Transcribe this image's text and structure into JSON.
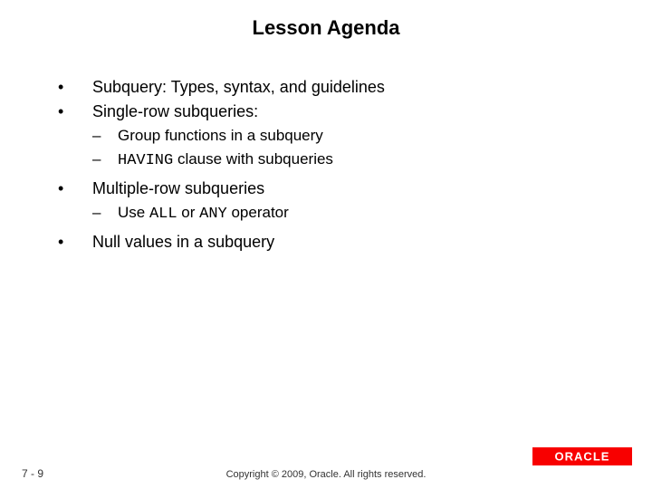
{
  "title": "Lesson Agenda",
  "bullets": {
    "b0": "Subquery: Types, syntax, and guidelines",
    "b1": "Single-row subqueries:",
    "b1_subs": {
      "s0": "Group functions in a subquery",
      "s1_code": "HAVING",
      "s1_rest": " clause with subqueries"
    },
    "b2": "Multiple-row subqueries",
    "b2_subs": {
      "s0_pre": "Use ",
      "s0_code1": "ALL",
      "s0_mid": " or ",
      "s0_code2": "ANY",
      "s0_post": " operator"
    },
    "b3": "Null values in a subquery"
  },
  "footer": {
    "page": "7 - 9",
    "copyright": "Copyright © 2009, Oracle. All rights reserved."
  },
  "logo": {
    "name": "ORACLE"
  }
}
